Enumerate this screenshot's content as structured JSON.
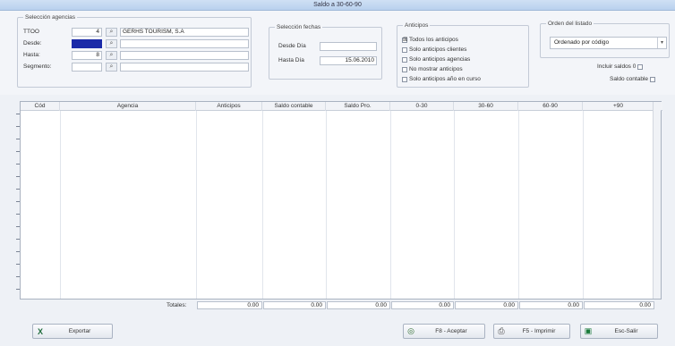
{
  "window": {
    "title": "Saldo a 30-60-90"
  },
  "agencias": {
    "legend": "Selección agencias",
    "rows": [
      {
        "label": "TTOO",
        "value": "4",
        "name": "GERHS TOURISM, S.A"
      },
      {
        "label": "Desde:",
        "value": "",
        "name": ""
      },
      {
        "label": "Hasta:",
        "value": "8",
        "name": ""
      },
      {
        "label": "Segmento:",
        "value": "",
        "name": ""
      }
    ]
  },
  "fechas": {
    "legend": "Selección fechas",
    "desde_label": "Desde Día",
    "desde_value": "",
    "hasta_label": "Hasta Día",
    "hasta_value": "15.06.2010"
  },
  "anticipos": {
    "legend": "Anticipos",
    "options": [
      {
        "label": "Todos los anticipos",
        "checked": "☒"
      },
      {
        "label": "Solo anticipos clientes",
        "checked": ""
      },
      {
        "label": "Solo anticipos agencias",
        "checked": ""
      },
      {
        "label": "No mostrar anticipos",
        "checked": ""
      },
      {
        "label": "Solo anticipos año en curso",
        "checked": ""
      }
    ]
  },
  "orden": {
    "legend": "Orden del listado",
    "value": "Ordenado por código",
    "incluir_label": "Incluir saldos 0",
    "contable_label": "Saldo contable"
  },
  "table": {
    "columns": [
      "Cód",
      "Agencia",
      "Anticipos",
      "Saldo contable",
      "Saldo Pro.",
      "0-30",
      "30-60",
      "60-90",
      "+90"
    ]
  },
  "totales": {
    "label": "Totales:",
    "values": [
      "0.00",
      "0.00",
      "0.00",
      "0.00",
      "0.00",
      "0.00",
      "0.00"
    ]
  },
  "buttons": {
    "export": "Exportar",
    "f8": "F8 - Aceptar",
    "f5": "F5 - Imprimir",
    "esc": "Esc-Salir"
  }
}
